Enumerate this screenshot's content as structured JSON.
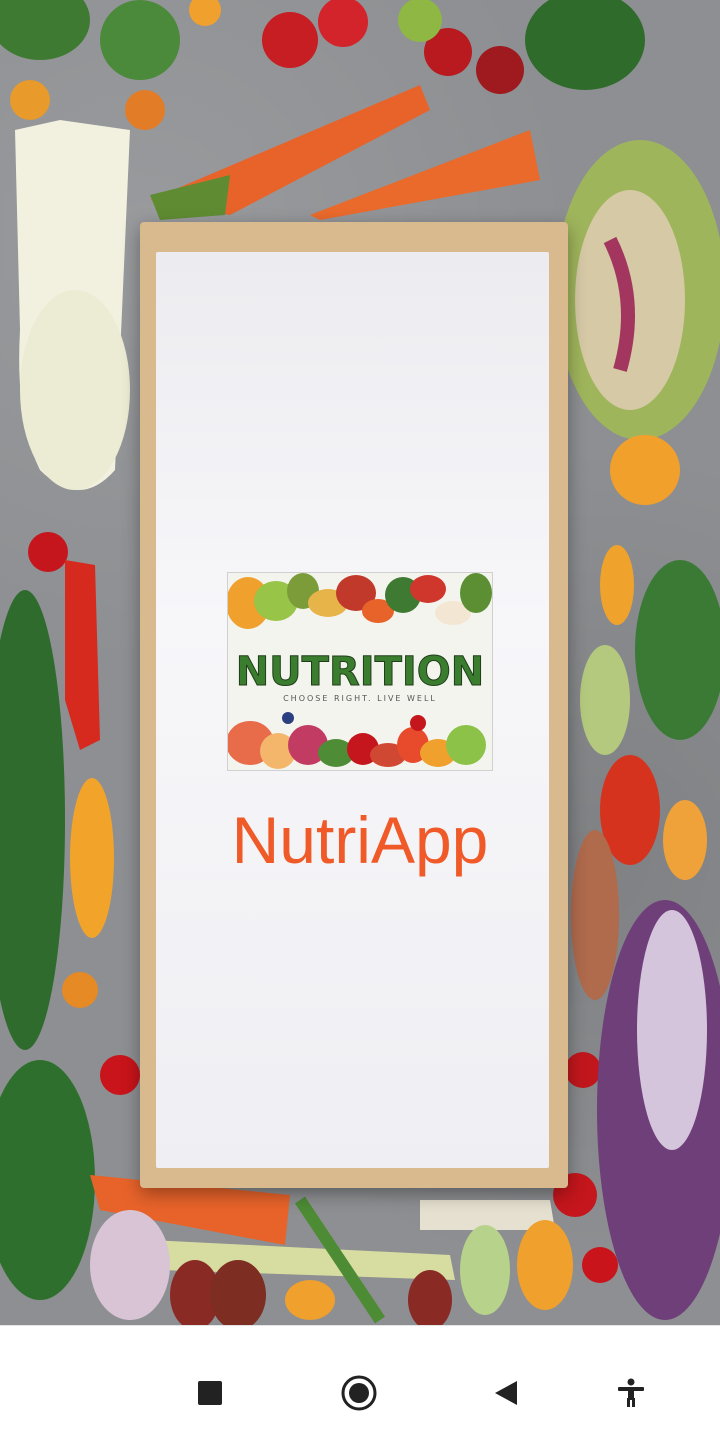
{
  "app": {
    "name": "NutriApp"
  },
  "logo": {
    "title": "NUTRITION",
    "tagline": "CHOOSE RIGHT. LIVE WELL"
  },
  "navbar": {
    "buttons": [
      {
        "icon": "recents-square-icon"
      },
      {
        "icon": "home-circle-icon"
      },
      {
        "icon": "back-triangle-icon"
      },
      {
        "icon": "accessibility-icon"
      }
    ]
  },
  "colors": {
    "app_name": "#f05a28",
    "background": "#8d8f92",
    "board": "#d9b98e"
  }
}
